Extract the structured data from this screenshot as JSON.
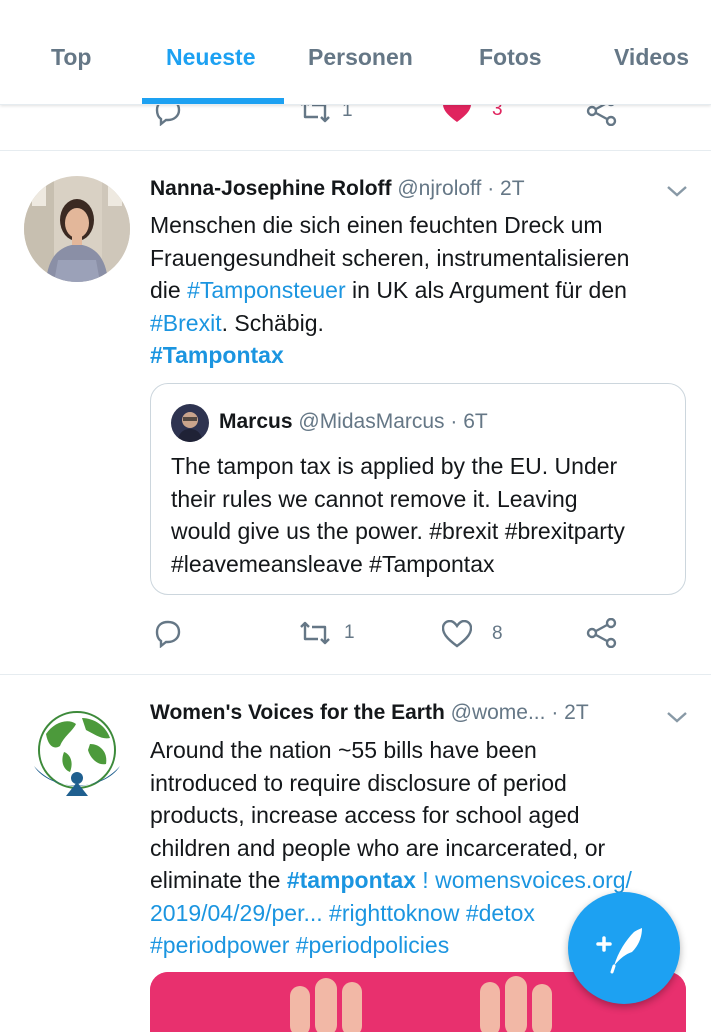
{
  "tabs": [
    {
      "label": "Top",
      "active": false
    },
    {
      "label": "Neueste",
      "active": true
    },
    {
      "label": "Personen",
      "active": false
    },
    {
      "label": "Fotos",
      "active": false
    },
    {
      "label": "Videos",
      "active": false
    }
  ],
  "colors": {
    "accent": "#1da1f2",
    "link": "#1b95e0",
    "like_red": "#e0245e",
    "muted": "#657786"
  },
  "top_partial_actions": {
    "retweets": "1",
    "likes": "3",
    "liked": true
  },
  "tweets": [
    {
      "name": "Nanna-Josephine Roloff",
      "handle": "@njroloff",
      "sep": "·",
      "time": "2T",
      "text": {
        "line1": "Menschen die sich einen feuchten Dreck um",
        "line2": "Frauengesundheit scheren, instrumentalisieren",
        "line3_pre": "die ",
        "line3_tag": "#Tamponsteuer",
        "line3_post": " in UK als Argument für den",
        "line4_tag": "#Brexit",
        "line4_post": ". Schäbig.",
        "line5_tag": "#Tampontax"
      },
      "quote": {
        "name": "Marcus",
        "handle": "@MidasMarcus",
        "sep": "·",
        "time": "6T",
        "line1": "The tampon tax is applied by the EU. Under",
        "line2": "their rules we cannot remove it. Leaving",
        "line3": "would give us the power. #brexit #brexitparty",
        "line4": "#leavemeansleave #Tampontax"
      },
      "actions": {
        "retweets": "1",
        "likes": "8"
      },
      "avatar_icon": "person-avatar-photo"
    },
    {
      "name": "Women's Voices for the Earth",
      "handle": "@wome...",
      "sep": "·",
      "time": "2T",
      "text": {
        "line1": "Around the nation ~55 bills have been",
        "line2": "introduced to require disclosure of period",
        "line3": "products, increase access for school aged",
        "line4": "children and people who are incarcerated, or",
        "line5_pre": "eliminate the ",
        "line5_tag": "#tampontax",
        "line5_mid": " ! ",
        "line5_link": "womensvoices.org/",
        "line6_link": "2019/04/29/per...",
        "line6_tags": " #righttoknow #detox",
        "line7_tags": "#periodpower #periodpolicies"
      },
      "avatar_icon": "globe-logo-icon"
    }
  ],
  "fab": {
    "icon": "compose-tweet-icon"
  }
}
